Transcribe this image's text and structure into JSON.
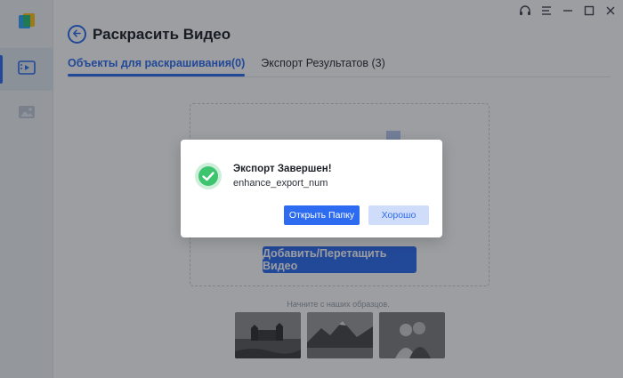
{
  "header": {
    "title": "Раскрасить Видео"
  },
  "tabs": [
    {
      "label": "Объекты для раскрашивания(0)",
      "active": true
    },
    {
      "label": "Экспорт Результатов (3)",
      "active": false
    }
  ],
  "sidebar": {
    "items": [
      {
        "icon": "logo-icon"
      },
      {
        "icon": "video-colorize-icon",
        "active": true
      },
      {
        "icon": "image-icon",
        "active": false
      }
    ]
  },
  "window_controls": [
    "headset-icon",
    "menu-icon",
    "minimize-icon",
    "maximize-icon",
    "close-icon"
  ],
  "main": {
    "add_button": "Добавить/Перетащить Видео",
    "samples_label": "Начните с наших образцов."
  },
  "dialog": {
    "title": "Экспорт Завершен!",
    "message": "enhance_export_num",
    "open_folder_button": "Открыть Папку",
    "ok_button": "Хорошо"
  },
  "colors": {
    "accent": "#2d6cf0",
    "success": "#3cc46e"
  }
}
